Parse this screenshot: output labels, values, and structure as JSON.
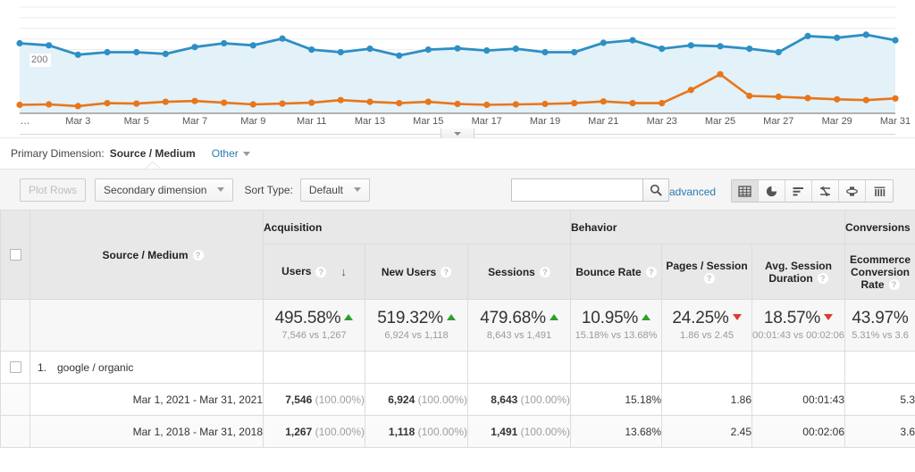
{
  "chart": {
    "axis_value_label": "200",
    "leading_tick_label": "…",
    "x_labels": [
      "Mar 3",
      "Mar 5",
      "Mar 7",
      "Mar 9",
      "Mar 11",
      "Mar 13",
      "Mar 15",
      "Mar 17",
      "Mar 19",
      "Mar 21",
      "Mar 23",
      "Mar 25",
      "Mar 27",
      "Mar 29",
      "Mar 31"
    ],
    "series_colors": {
      "primary": "#2d8fc4",
      "secondary": "#e8761a",
      "area_fill": "#e3f1f8"
    }
  },
  "chart_data": {
    "type": "line",
    "title": "",
    "xlabel": "",
    "ylabel": "",
    "ylim": [
      0,
      500
    ],
    "grid": true,
    "legend_position": "none",
    "x": [
      "Mar 1",
      "Mar 2",
      "Mar 3",
      "Mar 4",
      "Mar 5",
      "Mar 6",
      "Mar 7",
      "Mar 8",
      "Mar 9",
      "Mar 10",
      "Mar 11",
      "Mar 12",
      "Mar 13",
      "Mar 14",
      "Mar 15",
      "Mar 16",
      "Mar 17",
      "Mar 18",
      "Mar 19",
      "Mar 20",
      "Mar 21",
      "Mar 22",
      "Mar 23",
      "Mar 24",
      "Mar 25",
      "Mar 26",
      "Mar 27",
      "Mar 28",
      "Mar 29",
      "Mar 30",
      "Mar 31"
    ],
    "tick_labels": [
      "…",
      "Mar 3",
      "Mar 5",
      "Mar 7",
      "Mar 9",
      "Mar 11",
      "Mar 13",
      "Mar 15",
      "Mar 17",
      "Mar 19",
      "Mar 21",
      "Mar 23",
      "Mar 25",
      "Mar 27",
      "Mar 29",
      "Mar 31"
    ],
    "series": [
      {
        "name": "Mar 1, 2021 - Mar 31, 2021",
        "color": "#2d8fc4",
        "values": [
          330,
          320,
          276,
          288,
          288,
          280,
          312,
          330,
          320,
          352,
          300,
          288,
          304,
          272,
          300,
          306,
          296,
          304,
          288,
          288,
          332,
          344,
          304,
          320,
          316,
          304,
          288,
          364,
          356,
          370,
          344
        ]
      },
      {
        "name": "Mar 1, 2018 - Mar 31, 2018",
        "color": "#e8761a",
        "values": [
          40,
          42,
          34,
          48,
          46,
          54,
          58,
          50,
          42,
          46,
          50,
          62,
          54,
          48,
          54,
          44,
          40,
          42,
          44,
          48,
          56,
          48,
          48,
          110,
          184,
          82,
          78,
          72,
          66,
          62,
          70
        ]
      }
    ]
  },
  "primary_dimension": {
    "label": "Primary Dimension:",
    "value": "Source / Medium",
    "other_label": "Other"
  },
  "controls": {
    "plot_rows_label": "Plot Rows",
    "secondary_dimension_label": "Secondary dimension",
    "sort_type_label": "Sort Type:",
    "sort_type_value": "Default",
    "search_placeholder": "",
    "search_value": "",
    "advanced_label": "advanced",
    "view_types": [
      {
        "name": "table-view",
        "icon": "table-icon",
        "active": true
      },
      {
        "name": "percentage-view",
        "icon": "pie-chart-icon",
        "active": false
      },
      {
        "name": "performance-view",
        "icon": "horizontal-bars-icon",
        "active": false
      },
      {
        "name": "comparison-view",
        "icon": "comparison-icon",
        "active": false
      },
      {
        "name": "pivot-view",
        "icon": "pivot-icon",
        "active": false
      },
      {
        "name": "terms-view",
        "icon": "columns-icon",
        "active": false
      }
    ]
  },
  "table": {
    "group_headers": [
      {
        "label": "Acquisition"
      },
      {
        "label": "Behavior"
      },
      {
        "label": "Conversions"
      }
    ],
    "columns": [
      {
        "label": "Source / Medium",
        "help": "?",
        "sorted": false
      },
      {
        "label": "Users",
        "help": "?",
        "sorted": true,
        "sort_direction": "desc"
      },
      {
        "label": "New Users",
        "help": "?",
        "sorted": false
      },
      {
        "label": "Sessions",
        "help": "?",
        "sorted": false
      },
      {
        "label": "Bounce Rate",
        "help": "?",
        "sorted": false
      },
      {
        "label": "Pages / Session",
        "help": "?",
        "sorted": false
      },
      {
        "label": "Avg. Session Duration",
        "help": "?",
        "sorted": false
      },
      {
        "label": "Ecommerce Conversion Rate",
        "help": "?",
        "sorted": false
      }
    ],
    "summary": [
      {
        "pct": "495.58%",
        "dir": "up",
        "sub": "7,546 vs 1,267"
      },
      {
        "pct": "519.32%",
        "dir": "up",
        "sub": "6,924 vs 1,118"
      },
      {
        "pct": "479.68%",
        "dir": "up",
        "sub": "8,643 vs 1,491"
      },
      {
        "pct": "10.95%",
        "dir": "up",
        "sub": "15.18% vs 13.68%"
      },
      {
        "pct": "24.25%",
        "dir": "down",
        "sub": "1.86 vs 2.45"
      },
      {
        "pct": "18.57%",
        "dir": "down",
        "sub": "00:01:43 vs 00:02:06"
      },
      {
        "pct": "43.97%",
        "dir": "none",
        "sub": "5.31% vs 3.6"
      }
    ],
    "rows": [
      {
        "index": "1.",
        "name": "google / organic",
        "periods": [
          {
            "range": "Mar 1, 2021 - Mar 31, 2021",
            "users": "7,546",
            "users_pct": "(100.00%)",
            "new_users": "6,924",
            "new_users_pct": "(100.00%)",
            "sessions": "8,643",
            "sessions_pct": "(100.00%)",
            "bounce_rate": "15.18%",
            "pages_session": "1.86",
            "avg_duration": "00:01:43",
            "ecommerce_rate": "5.3"
          },
          {
            "range": "Mar 1, 2018 - Mar 31, 2018",
            "users": "1,267",
            "users_pct": "(100.00%)",
            "new_users": "1,118",
            "new_users_pct": "(100.00%)",
            "sessions": "1,491",
            "sessions_pct": "(100.00%)",
            "bounce_rate": "13.68%",
            "pages_session": "2.45",
            "avg_duration": "00:02:06",
            "ecommerce_rate": "3.6"
          }
        ]
      }
    ]
  }
}
